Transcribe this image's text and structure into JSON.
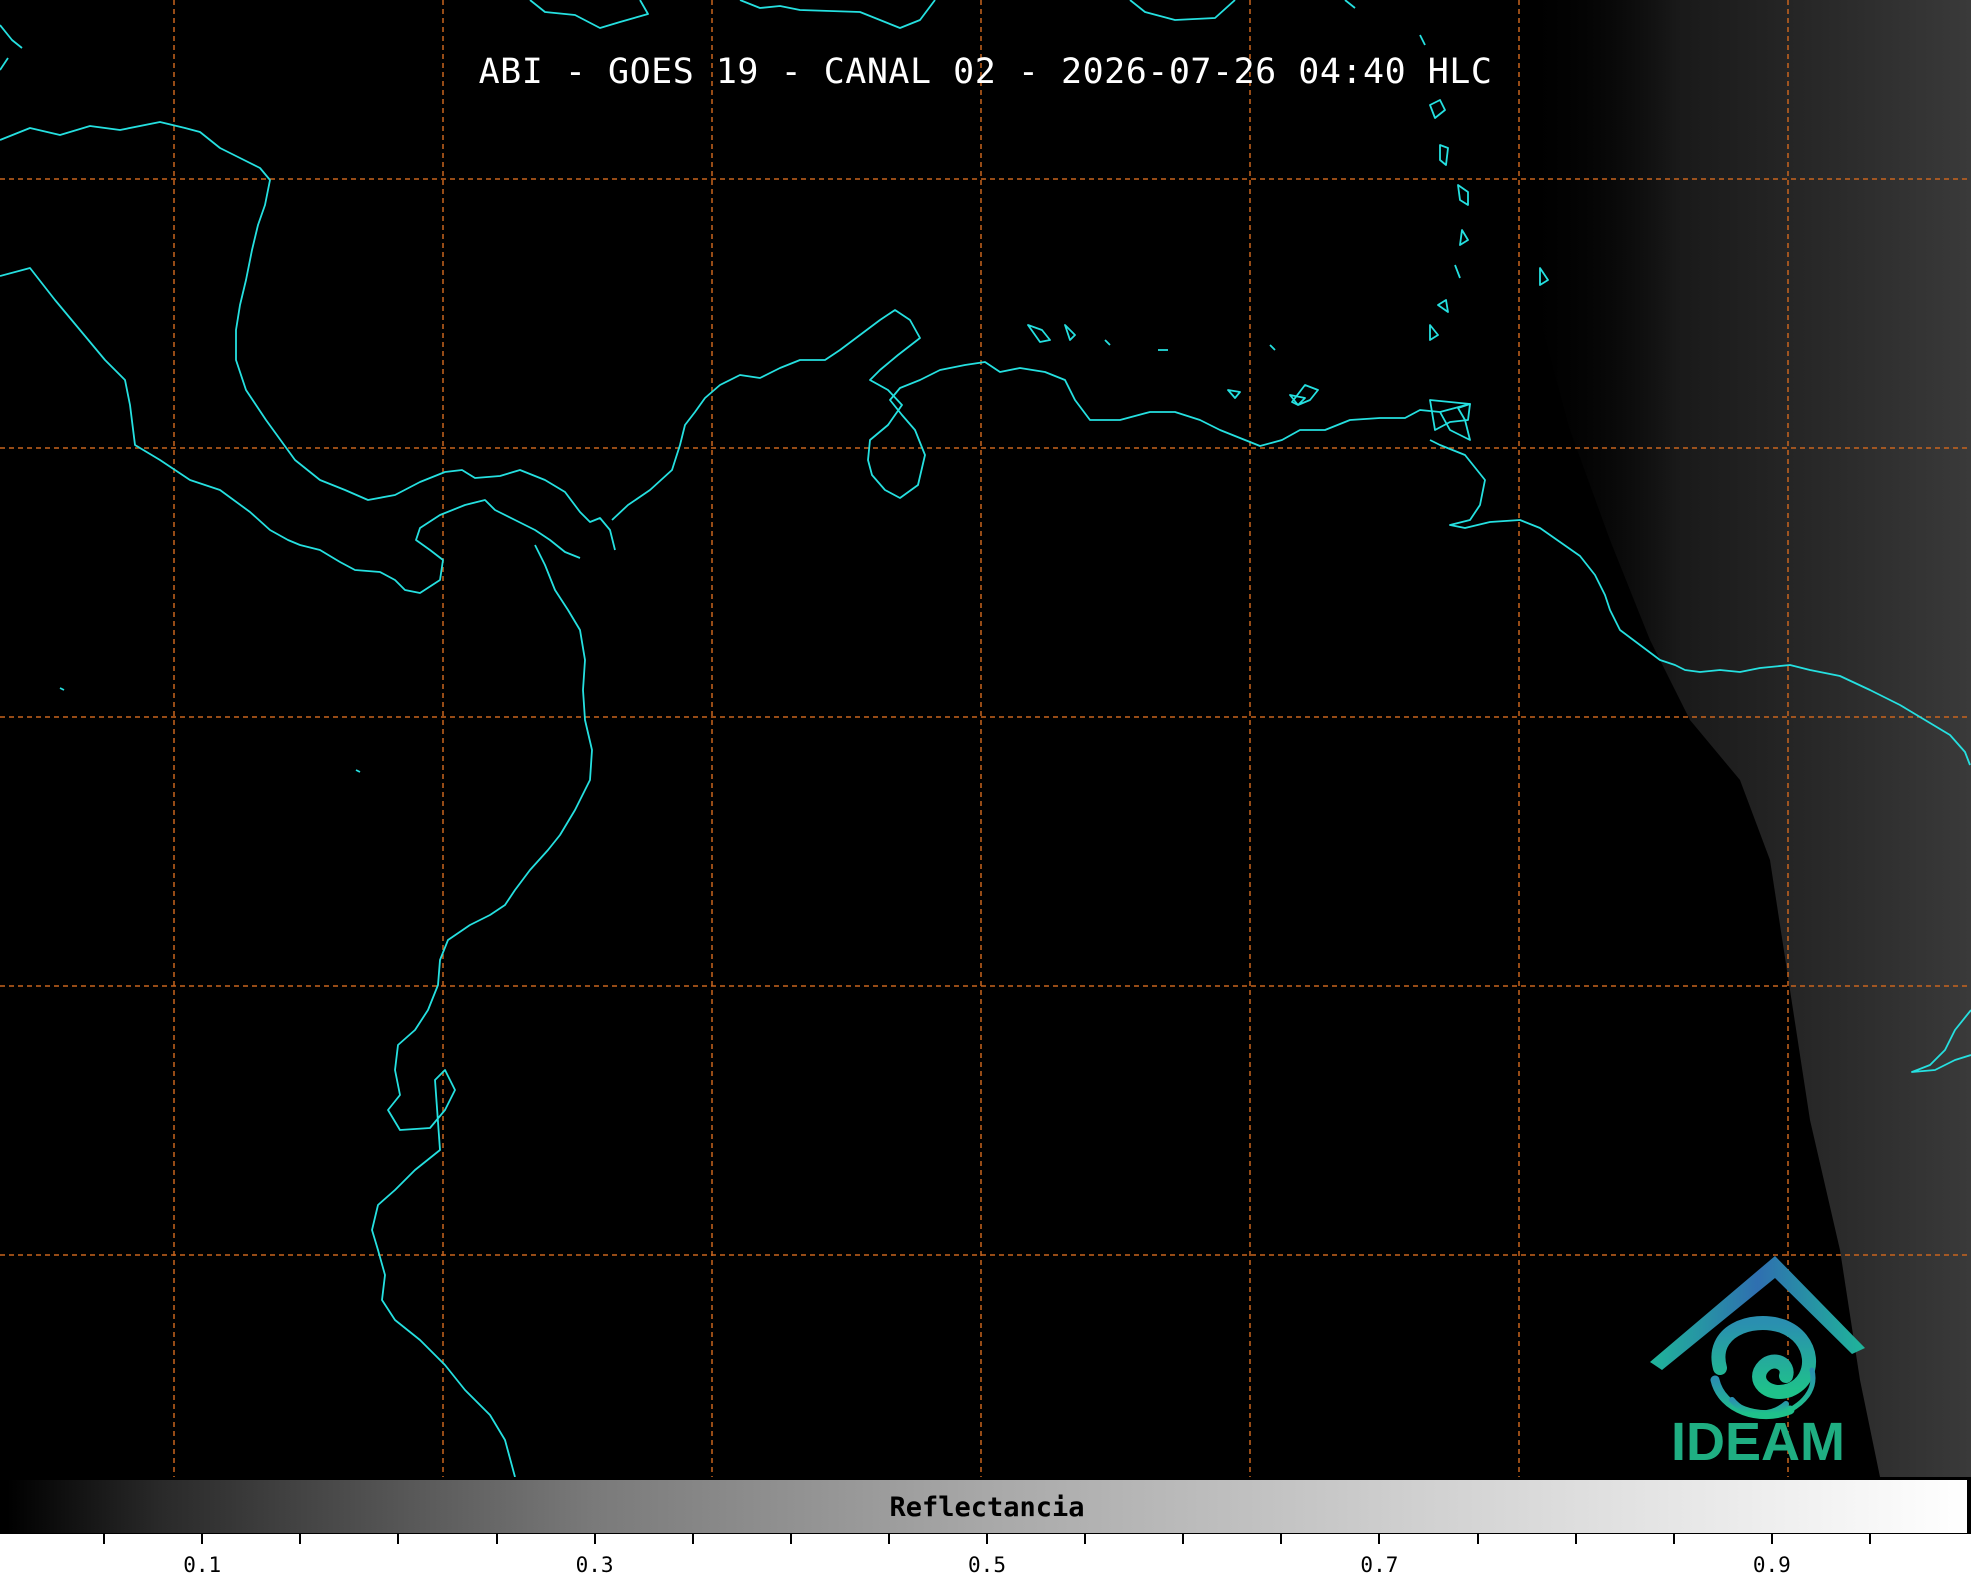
{
  "title": "ABI - GOES 19 - CANAL 02 - 2026-07-26 04:40 HLC",
  "colors": {
    "coastline": "#25e0e0",
    "gridline": "#c8641e",
    "background": "#000000",
    "logo_blue": "#2f6fb0",
    "logo_teal": "#1fb59a",
    "logo_text": "#1fae82"
  },
  "logo": {
    "text": "IDEAM",
    "icon": "ideam-mountain-swirl-icon"
  },
  "colorbar": {
    "label": "Reflectancia",
    "range": [
      0.0,
      1.0
    ],
    "colormap": "gray",
    "ticks": [
      "0.1",
      "0.3",
      "0.5",
      "0.7",
      "0.9"
    ]
  },
  "map": {
    "projection": "plate-carree",
    "gridlines": "dashed",
    "overlay": "coastlines",
    "lit_region": "right"
  }
}
